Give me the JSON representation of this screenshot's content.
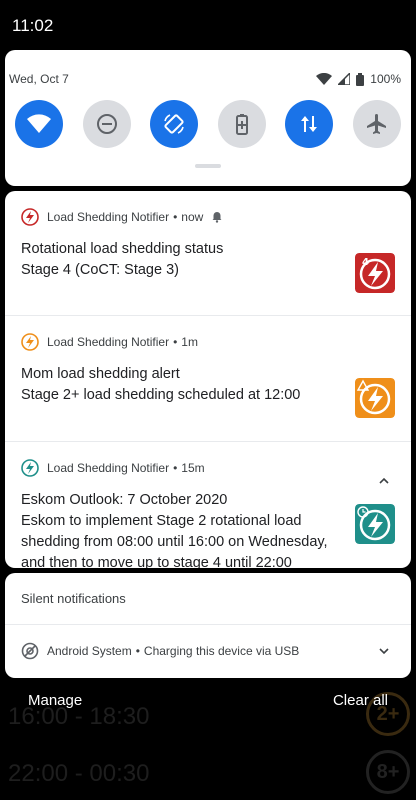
{
  "status_bar": {
    "time": "11:02"
  },
  "quick_settings": {
    "date": "Wed, Oct 7",
    "battery": "100%",
    "tiles": [
      {
        "name": "wifi",
        "on": true
      },
      {
        "name": "do-not-disturb",
        "on": false
      },
      {
        "name": "auto-rotate",
        "on": true
      },
      {
        "name": "battery-saver",
        "on": false
      },
      {
        "name": "mobile-data",
        "on": true
      },
      {
        "name": "airplane-mode",
        "on": false
      }
    ]
  },
  "notifications": [
    {
      "app": "Load Shedding Notifier",
      "time": "now",
      "title": "Rotational load shedding status",
      "text": "Stage 4 (CoCT: Stage 3)",
      "icon_color": "#c62828",
      "badge": "4"
    },
    {
      "app": "Load Shedding Notifier",
      "time": "1m",
      "title": "Mom load shedding alert",
      "text": "Stage 2+ load shedding scheduled at 12:00",
      "icon_color": "#ef8f1a"
    },
    {
      "app": "Load Shedding Notifier",
      "time": "15m",
      "title": "Eskom Outlook: 7 October 2020",
      "text": "Eskom to implement Stage 2 rotational load shedding from 08:00 until 16:00 on Wednesday, and then to move up to stage 4 until 22:00",
      "icon_color": "#1f8f8a"
    }
  ],
  "silent": {
    "header": "Silent notifications",
    "app": "Android System",
    "text": "Charging this device via USB"
  },
  "actions": {
    "manage": "Manage",
    "clear_all": "Clear all"
  },
  "background": {
    "rows": [
      "16:00 - 18:30",
      "22:00 - 00:30"
    ],
    "badges": [
      "2+",
      "8+"
    ]
  }
}
